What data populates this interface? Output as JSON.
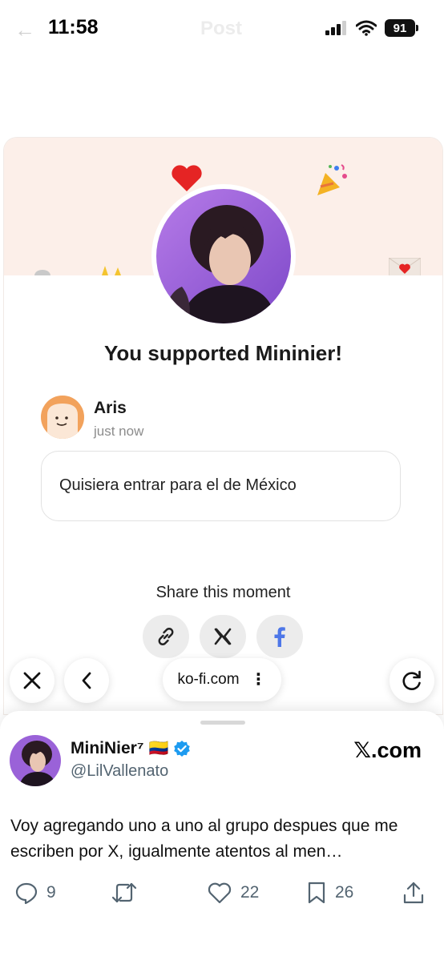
{
  "status_bar": {
    "time": "11:58",
    "battery": "91",
    "background_title": "Post"
  },
  "kofi": {
    "heading": "You supported Mininier!",
    "supporter": {
      "name": "Aris",
      "time": "just now",
      "message": "Quisiera entrar para el de México"
    },
    "share_label": "Share this moment"
  },
  "browser": {
    "url": "ko-fi.com"
  },
  "tweet": {
    "display_name": "MiniNier⁷",
    "flag": "🇨🇴",
    "handle": "@LilVallenato",
    "site": "𝕏.com",
    "text": "Voy agregando uno a uno al grupo despues que me escriben por X, igualmente atentos al men…",
    "replies": "9",
    "likes": "22",
    "bookmarks": "26"
  },
  "colors": {
    "banner": "#fcefe9",
    "verified": "#1d9bf0",
    "facebook": "#4e77e8",
    "muted_text": "#536471"
  }
}
